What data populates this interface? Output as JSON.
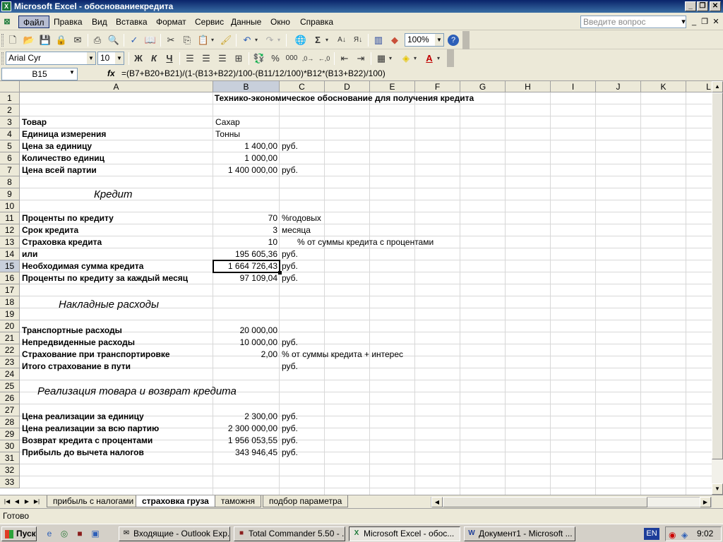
{
  "window": {
    "title": "Microsoft Excel - обоснованиекредита"
  },
  "menu": {
    "items": [
      "Файл",
      "Правка",
      "Вид",
      "Вставка",
      "Формат",
      "Сервис",
      "Данные",
      "Окно",
      "Справка"
    ],
    "help_placeholder": "Введите вопрос"
  },
  "toolbar": {
    "zoom": "100%",
    "font_name": "Arial Cyr",
    "font_size": "10",
    "bold": "Ж",
    "italic": "К",
    "underline": "Ч"
  },
  "formula_bar": {
    "name_box": "B15",
    "fx": "fx",
    "formula": "=(B7+B20+B21)/(1-(B13+B22)/100-(B11/12/100)*B12*(B13+B22)/100)"
  },
  "columns": [
    "A",
    "B",
    "C",
    "D",
    "E",
    "F",
    "G",
    "H",
    "I",
    "J",
    "K",
    "L"
  ],
  "rows": [
    "1",
    "2",
    "3",
    "4",
    "5",
    "6",
    "7",
    "8",
    "9",
    "10",
    "11",
    "12",
    "13",
    "14",
    "15",
    "16",
    "17",
    "18",
    "19",
    "20",
    "21",
    "22",
    "23",
    "24",
    "25",
    "26",
    "27",
    "28",
    "29",
    "30",
    "31",
    "32",
    "33"
  ],
  "cells": {
    "r1": "Технико-экономическое обоснование для получения кредита",
    "r3a": "Товар",
    "r3b": "Сахар",
    "r4a": "Единица измерения",
    "r4b": "Тонны",
    "r5a": "Цена за единицу",
    "r5b": "1 400,00",
    "r5c": "руб.",
    "r6a": "Количество единиц",
    "r6b": "1 000,00",
    "r7a": "Цена всей партии",
    "r7b": "1 400 000,00",
    "r7c": "руб.",
    "r9": "Кредит",
    "r11a": "Проценты по кредиту",
    "r11b": "70",
    "r11c": "%годовых",
    "r12a": "Срок кредита",
    "r12b": "3",
    "r12c": "месяца",
    "r13a": "Страховка кредита",
    "r13b": "10",
    "r13c": "% от суммы кредита с процентами",
    "r14a": "или",
    "r14b": "195 605,36",
    "r14c": "руб.",
    "r15a": "Необходимая сумма кредита",
    "r15b": "1 664 726,43",
    "r15c": "руб.",
    "r16a": "Проценты по кредиту за каждый месяц",
    "r16b": "97 109,04",
    "r16c": "руб.",
    "r18": "Накладные расходы",
    "r20a": "Транспортные расходы",
    "r20b": "20 000,00",
    "r21a": "Непредвиденные расходы",
    "r21b": "10 000,00",
    "r21c": "руб.",
    "r22a": "Страхование при транспортировке",
    "r22b": "2,00",
    "r22c": "% от суммы кредита + интерес",
    "r23a": "Итого страхование в пути",
    "r23c": "руб.",
    "r25": "Реализация товара и возврат кредита",
    "r27a": "Цена реализации за единицу",
    "r27b": "2 300,00",
    "r27c": "руб.",
    "r28a": "Цена реализации за всю партию",
    "r28b": "2 300 000,00",
    "r28c": "руб.",
    "r29a": "Возврат кредита с процентами",
    "r29b": "1 956 053,55",
    "r29c": "руб.",
    "r30a": "Прибыль до вычета налогов",
    "r30b": "343 946,45",
    "r30c": "руб."
  },
  "sheet_tabs": [
    "прибыль с налогами",
    "страховка груза",
    "таможня",
    "подбор параметра"
  ],
  "active_tab": "страховка груза",
  "status": "Готово",
  "taskbar": {
    "start": "Пуск",
    "tasks": [
      "Входящие - Outlook Exp...",
      "Total Commander 5.50 - ...",
      "Microsoft Excel - обос...",
      "Документ1 - Microsoft ..."
    ],
    "lang": "EN",
    "clock": "9:02"
  }
}
